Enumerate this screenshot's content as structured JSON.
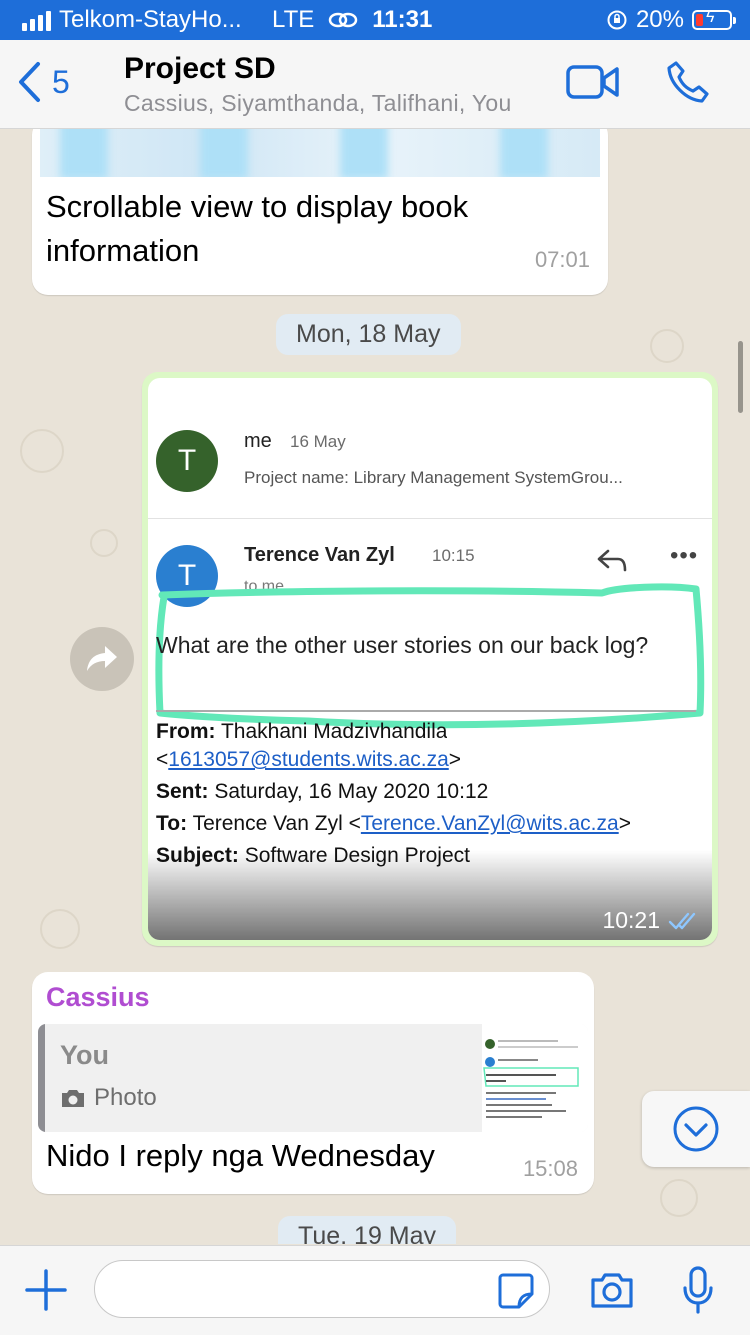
{
  "status_bar": {
    "carrier": "Telkom-StayHo...",
    "network": "LTE",
    "time": "11:31",
    "battery": "20%"
  },
  "header": {
    "back_count": "5",
    "title": "Project SD",
    "subtitle": "Cassius, Siyamthanda, Talifhani, You"
  },
  "messages": [
    {
      "text": "Scrollable view to display book information",
      "time": "07:01"
    },
    {
      "date_separator": "Mon, 18 May"
    },
    {
      "type": "image",
      "time": "10:21",
      "email": {
        "first_avatar": "T",
        "first_from": "me",
        "first_date": "16 May",
        "first_preview": "Project name: Library Management SystemGrou...",
        "second_avatar": "T",
        "second_sender": "Terence Van Zyl",
        "second_time": "10:15",
        "to_me": "to me",
        "question": "What are the other user stories on our back log?",
        "from_label": "From:",
        "from_name": "Thakhani Madzivhandila",
        "from_lt": "<",
        "from_email": "1613057@students.wits.ac.za",
        "from_gt": ">",
        "sent_label": "Sent:",
        "sent_value": "Saturday, 16 May 2020 10:12",
        "to_label": "To:",
        "to_name": "Terence Van Zyl <",
        "to_email": "Terence.VanZyl@wits.ac.za",
        "to_gt": ">",
        "subject_label": "Subject:",
        "subject_value": "Software Design Project"
      }
    },
    {
      "sender": "Cassius",
      "quote_author": "You",
      "quote_type": "Photo",
      "text": "Nido I reply nga Wednesday",
      "time": "15:08"
    },
    {
      "date_separator": "Tue, 19 May"
    }
  ],
  "input": {
    "placeholder": ""
  },
  "colors": {
    "ios_blue": "#1e6ed9",
    "sender_purple": "#b04dd1",
    "outgoing_bubble": "#dcf8c6",
    "highlight_mint": "#62e8b8"
  }
}
